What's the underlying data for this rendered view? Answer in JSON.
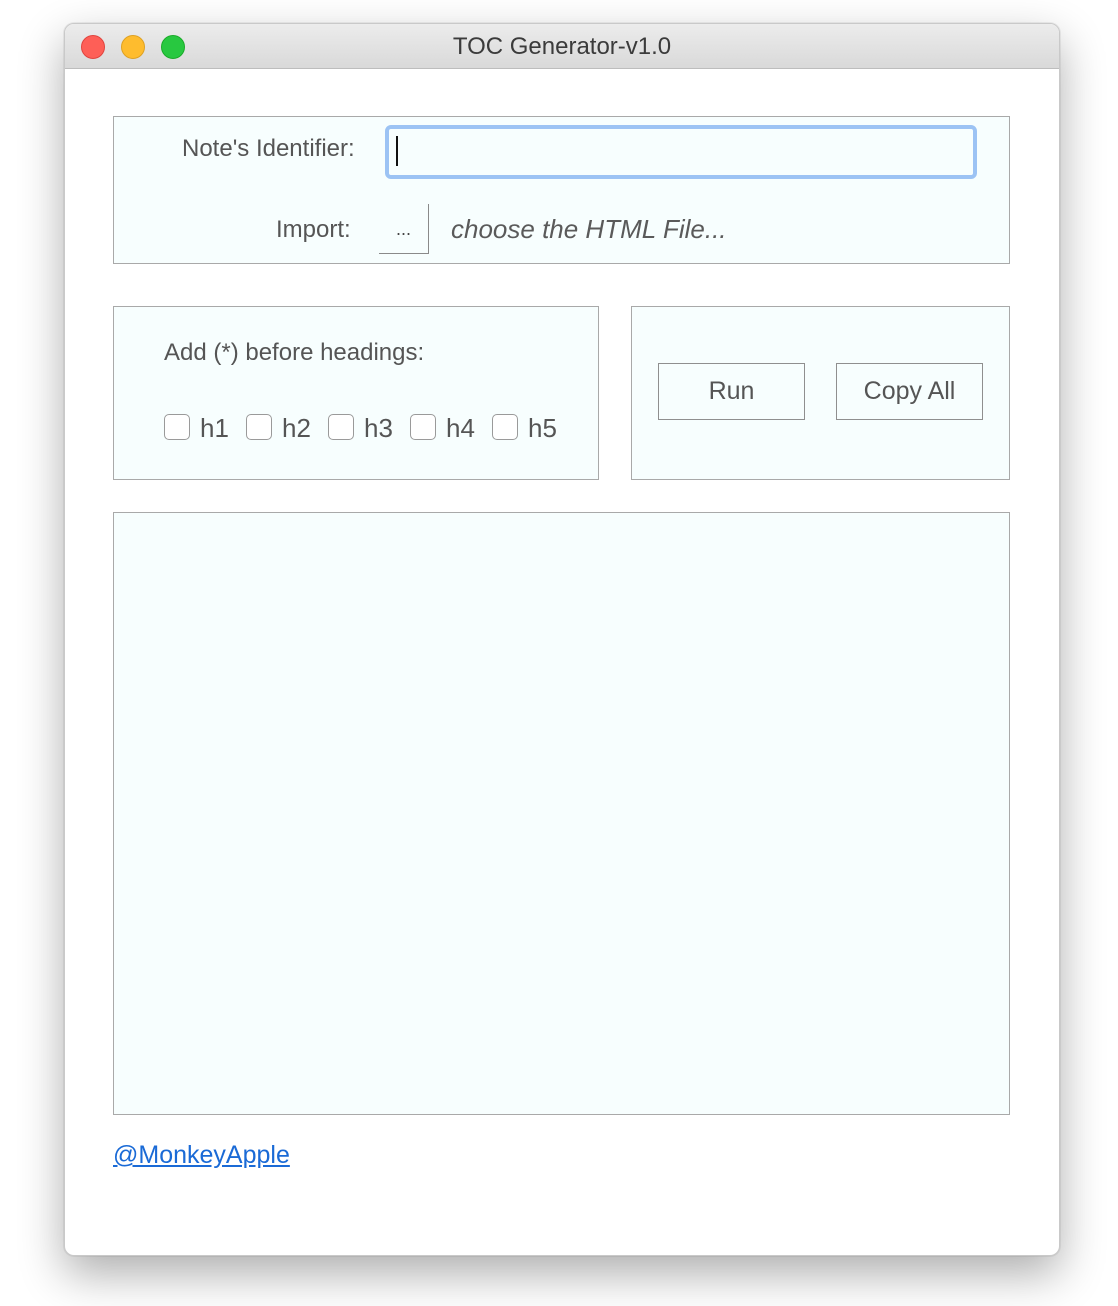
{
  "window": {
    "title": "TOC Generator-v1.0"
  },
  "identifier": {
    "label": "Note's Identifier:",
    "value": ""
  },
  "import": {
    "label": "Import:",
    "button_label": "...",
    "hint": "choose the HTML File..."
  },
  "headings": {
    "label": "Add (*) before headings:",
    "options": [
      {
        "label": "h1",
        "checked": false
      },
      {
        "label": "h2",
        "checked": false
      },
      {
        "label": "h3",
        "checked": false
      },
      {
        "label": "h4",
        "checked": false
      },
      {
        "label": "h5",
        "checked": false
      }
    ]
  },
  "actions": {
    "run_label": "Run",
    "copy_label": "Copy All"
  },
  "output": {
    "text": ""
  },
  "footer": {
    "link_text": "@MonkeyApple"
  },
  "colors": {
    "panel_bg": "#f7fefe",
    "focus_ring": "#9cc3f4",
    "link": "#1a6ad6",
    "close": "#fe5f57",
    "minimize": "#febc2e",
    "maximize": "#28c840"
  }
}
